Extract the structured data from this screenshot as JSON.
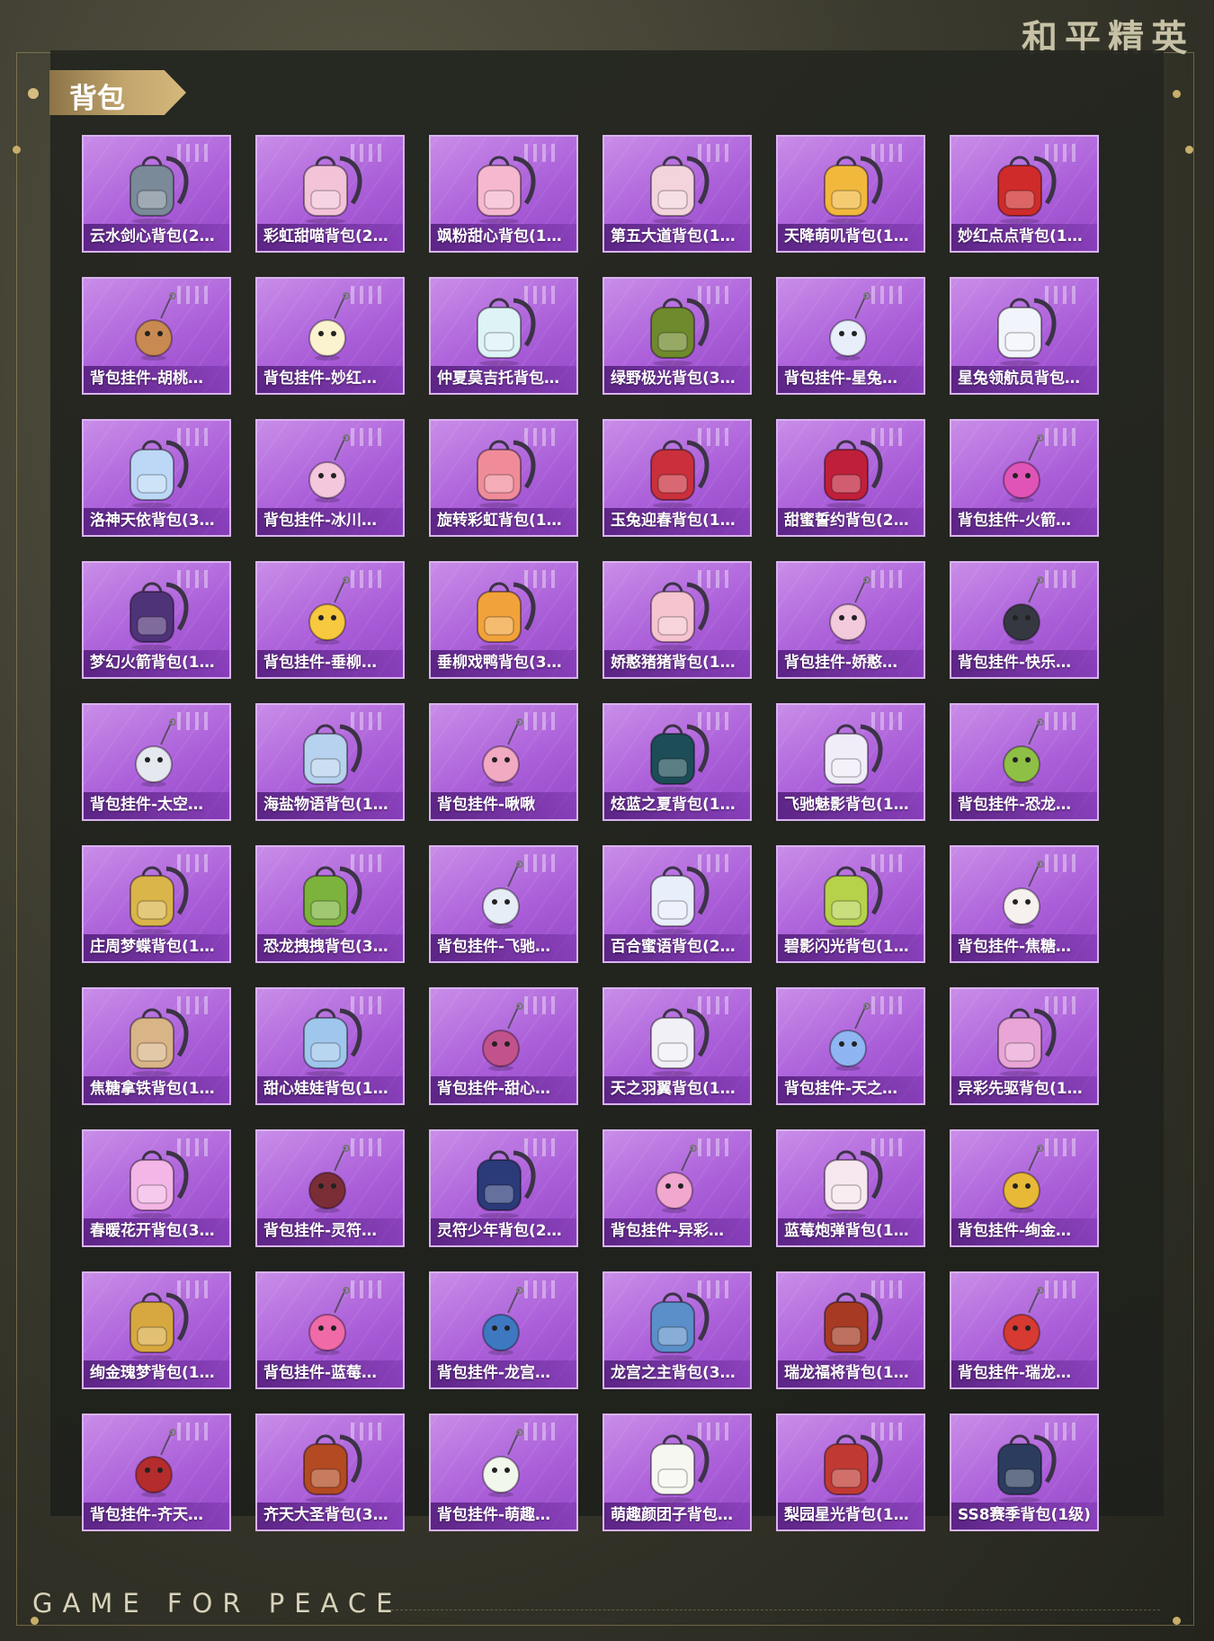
{
  "brand": {
    "title": "和平精英",
    "footer": "GAME FOR PEACE"
  },
  "section": {
    "title": "背包"
  },
  "items": [
    {
      "label": "云水剑心背包(2…",
      "icon": "sword-backpack-icon",
      "color": "#7a8a99"
    },
    {
      "label": "彩虹甜喵背包(2…",
      "icon": "cat-backpack-icon",
      "color": "#f3c3d8"
    },
    {
      "label": "飒粉甜心背包(1…",
      "icon": "pink-backpack-icon",
      "color": "#f6b8cf"
    },
    {
      "label": "第五大道背包(1…",
      "icon": "handbag-backpack-icon",
      "color": "#f4d4dc"
    },
    {
      "label": "天降萌叽背包(1…",
      "icon": "yellow-backpack-icon",
      "color": "#f1b83c"
    },
    {
      "label": "妙红点点背包(1…",
      "icon": "red-backpack-icon",
      "color": "#cf2b2b"
    },
    {
      "label": "背包挂件-胡桃…",
      "icon": "nutcracker-charm-icon",
      "color": "#c98a52"
    },
    {
      "label": "背包挂件-妙红…",
      "icon": "flower-charm-icon",
      "color": "#fbf2d0"
    },
    {
      "label": "仲夏莫吉托背包…",
      "icon": "drink-backpack-icon",
      "color": "#ddf3f6"
    },
    {
      "label": "绿野极光背包(3…",
      "icon": "green-backpack-icon",
      "color": "#6e8a2c"
    },
    {
      "label": "背包挂件-星兔…",
      "icon": "rocket-charm-icon",
      "color": "#e8eefa"
    },
    {
      "label": "星兔领航员背包…",
      "icon": "bunny-backpack-icon",
      "color": "#f2f4fb"
    },
    {
      "label": "洛神天依背包(3…",
      "icon": "crystal-backpack-icon",
      "color": "#bcd8f6"
    },
    {
      "label": "背包挂件-冰川…",
      "icon": "cloud-charm-icon",
      "color": "#f4c7dd"
    },
    {
      "label": "旋转彩虹背包(1…",
      "icon": "rainbow-backpack-icon",
      "color": "#f08c9a"
    },
    {
      "label": "玉兔迎春背包(1…",
      "icon": "bunny-red-backpack-icon",
      "color": "#c9303c"
    },
    {
      "label": "甜蜜誓约背包(2…",
      "icon": "heart-backpack-icon",
      "color": "#c01f3a"
    },
    {
      "label": "背包挂件-火箭…",
      "icon": "rocket-pink-charm-icon",
      "color": "#e154b7"
    },
    {
      "label": "梦幻火箭背包(1…",
      "icon": "dark-rocket-backpack-icon",
      "color": "#4f3378"
    },
    {
      "label": "背包挂件-垂柳…",
      "icon": "duck-charm-icon",
      "color": "#f6c93e"
    },
    {
      "label": "垂柳戏鸭背包(3…",
      "icon": "duck-backpack-icon",
      "color": "#f2a23a"
    },
    {
      "label": "娇憨猪猪背包(1…",
      "icon": "pig-backpack-icon",
      "color": "#f5c4cf"
    },
    {
      "label": "背包挂件-娇憨…",
      "icon": "pig-charm-icon",
      "color": "#f3c9dc"
    },
    {
      "label": "背包挂件-快乐…",
      "icon": "helmet-charm-icon",
      "color": "#353840"
    },
    {
      "label": "背包挂件-太空…",
      "icon": "astronaut-charm-icon",
      "color": "#e5e8ef"
    },
    {
      "label": "海盐物语背包(1…",
      "icon": "blue-backpack-icon",
      "color": "#b7d2ee"
    },
    {
      "label": "背包挂件-啾啾",
      "icon": "bird-charm-icon",
      "color": "#f2a9c2"
    },
    {
      "label": "炫蓝之夏背包(1…",
      "icon": "teal-backpack-icon",
      "color": "#1d4d57"
    },
    {
      "label": "飞驰魅影背包(1…",
      "icon": "white-backpack-icon",
      "color": "#f0ecf8"
    },
    {
      "label": "背包挂件-恐龙…",
      "icon": "dino-egg-charm-icon",
      "color": "#8fc046"
    },
    {
      "label": "庄周梦蝶背包(1…",
      "icon": "gold-backpack-icon",
      "color": "#d9b54a"
    },
    {
      "label": "恐龙拽拽背包(3…",
      "icon": "dino-backpack-icon",
      "color": "#7cb33c"
    },
    {
      "label": "背包挂件-飞驰…",
      "icon": "wing-charm-icon",
      "color": "#e6edf6"
    },
    {
      "label": "百合蜜语背包(2…",
      "icon": "lily-backpack-icon",
      "color": "#e9eefb"
    },
    {
      "label": "碧影闪光背包(1…",
      "icon": "lime-backpack-icon",
      "color": "#b5d24a"
    },
    {
      "label": "背包挂件-焦糖…",
      "icon": "bear-charm-icon",
      "color": "#f6f1ee"
    },
    {
      "label": "焦糖拿铁背包(1…",
      "icon": "latte-backpack-icon",
      "color": "#d9b486"
    },
    {
      "label": "甜心娃娃背包(1…",
      "icon": "doll-backpack-icon",
      "color": "#9fc6ec"
    },
    {
      "label": "背包挂件-甜心…",
      "icon": "umbrella-charm-icon",
      "color": "#c2528b"
    },
    {
      "label": "天之羽翼背包(1…",
      "icon": "wing-backpack-icon",
      "color": "#f1f0f6"
    },
    {
      "label": "背包挂件-天之…",
      "icon": "star-wand-charm-icon",
      "color": "#8fb6f2"
    },
    {
      "label": "异彩先驱背包(1…",
      "icon": "pastel-backpack-icon",
      "color": "#e9a5d6"
    },
    {
      "label": "春暖花开背包(3…",
      "icon": "butterfly-backpack-icon",
      "color": "#f3b6e6"
    },
    {
      "label": "背包挂件-灵符…",
      "icon": "talisman-charm-icon",
      "color": "#7a2d35"
    },
    {
      "label": "灵符少年背包(2…",
      "icon": "pouch-backpack-icon",
      "color": "#2b3a78"
    },
    {
      "label": "背包挂件-异彩…",
      "icon": "roller-skate-charm-icon",
      "color": "#f2a7cf"
    },
    {
      "label": "蓝莓炮弹背包(1…",
      "icon": "berry-backpack-icon",
      "color": "#f7e7ee"
    },
    {
      "label": "背包挂件-绚金…",
      "icon": "crown-charm-icon",
      "color": "#e8b937"
    },
    {
      "label": "绚金瑰梦背包(1…",
      "icon": "gold-rose-backpack-icon",
      "color": "#d7a83f"
    },
    {
      "label": "背包挂件-蓝莓…",
      "icon": "ice-cream-charm-icon",
      "color": "#f06aa7"
    },
    {
      "label": "背包挂件-龙宫…",
      "icon": "dragon-sword-charm-icon",
      "color": "#3d78c1"
    },
    {
      "label": "龙宫之主背包(3…",
      "icon": "dragon-backpack-icon",
      "color": "#5a8fc9"
    },
    {
      "label": "瑞龙福将背包(1…",
      "icon": "armor-backpack-icon",
      "color": "#a63a22"
    },
    {
      "label": "背包挂件-瑞龙…",
      "icon": "lucky-knot-charm-icon",
      "color": "#d63a31"
    },
    {
      "label": "背包挂件-齐天…",
      "icon": "staff-charm-icon",
      "color": "#b42c2c"
    },
    {
      "label": "齐天大圣背包(3…",
      "icon": "monkey-king-backpack-icon",
      "color": "#b34a22"
    },
    {
      "label": "背包挂件-萌趣…",
      "icon": "dumpling-charm-icon",
      "color": "#f2f7ec"
    },
    {
      "label": "萌趣颜团子背包…",
      "icon": "mochi-backpack-icon",
      "color": "#f5f7f0"
    },
    {
      "label": "梨园星光背包(1…",
      "icon": "opera-backpack-icon",
      "color": "#c03a33"
    },
    {
      "label": "SS8赛季背包(1级)",
      "icon": "navy-backpack-icon",
      "color": "#2c3c5e"
    }
  ]
}
